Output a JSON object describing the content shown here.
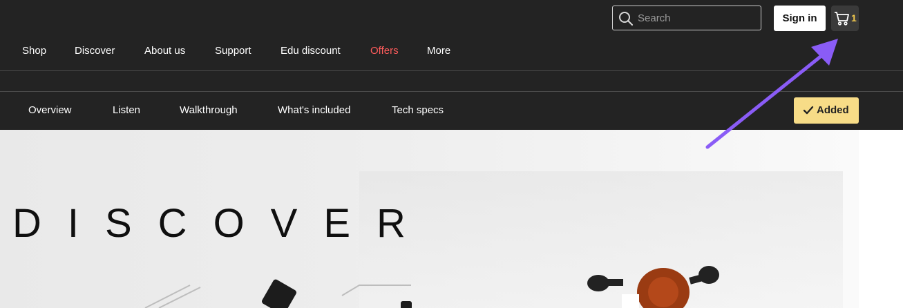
{
  "header": {
    "search_placeholder": "Search",
    "signin_label": "Sign in",
    "cart_count": "1"
  },
  "main_nav": [
    "Shop",
    "Discover",
    "About us",
    "Support",
    "Edu discount",
    "Offers",
    "More"
  ],
  "sub_nav": [
    "Overview",
    "Listen",
    "Walkthrough",
    "What's included",
    "Tech specs"
  ],
  "added_label": "Added",
  "hero": {
    "title": "DISCOVER"
  },
  "colors": {
    "nav_bg": "#232323",
    "offers": "#ff5c5c",
    "added_bg": "#f7dc87",
    "cart_count": "#f2c94c",
    "annotation_arrow": "#8a5cf6"
  }
}
